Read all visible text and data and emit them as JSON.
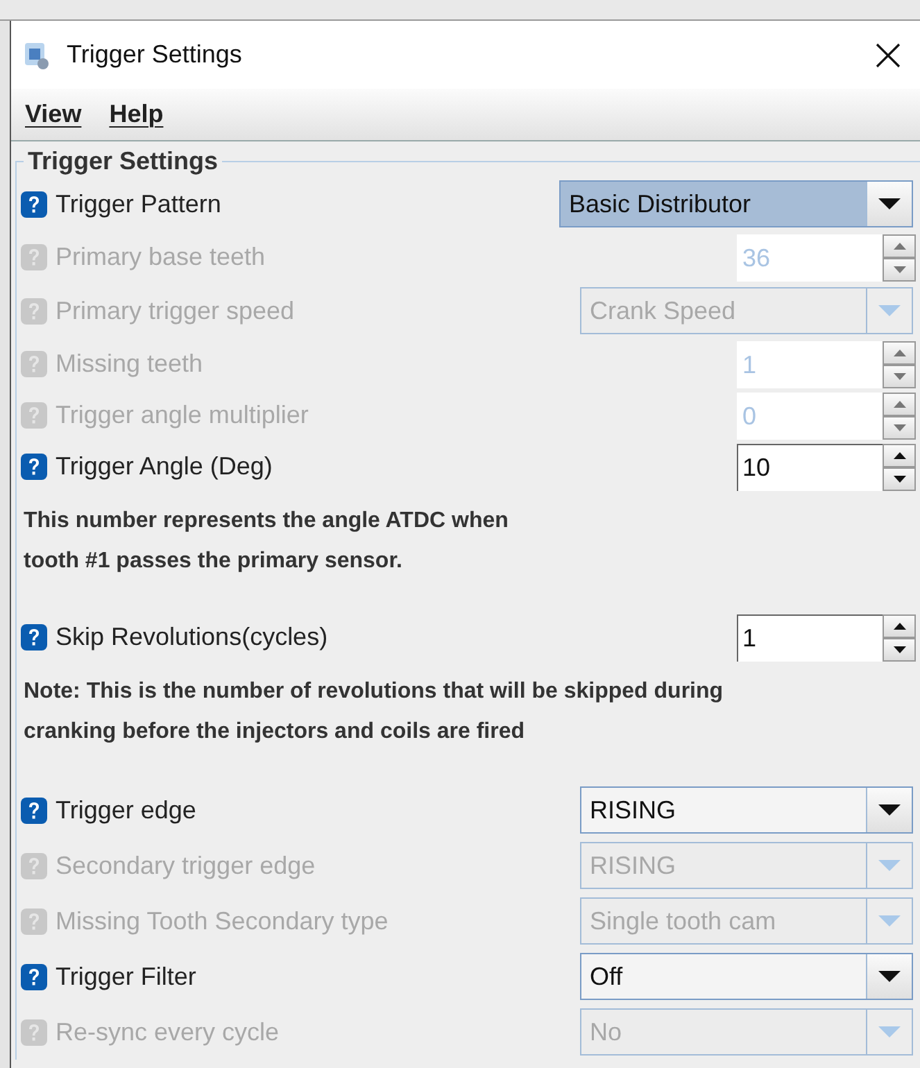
{
  "window": {
    "title": "Trigger Settings"
  },
  "menu": [
    {
      "label": "View"
    },
    {
      "label": "Help"
    }
  ],
  "group": {
    "title": "Trigger Settings"
  },
  "rows": [
    {
      "kind": "combo",
      "label": "Trigger Pattern",
      "value": "Basic Distributor",
      "disabled": false,
      "focused": true
    },
    {
      "kind": "spinner",
      "label": "Primary base teeth",
      "value": "36",
      "disabled": true
    },
    {
      "kind": "combo",
      "label": "Primary trigger speed",
      "value": "Crank Speed",
      "disabled": true,
      "focused": false
    },
    {
      "kind": "spinner",
      "label": "Missing teeth",
      "value": "1",
      "disabled": true
    },
    {
      "kind": "spinner",
      "label": "Trigger angle multiplier",
      "value": "0",
      "disabled": true
    },
    {
      "kind": "spinner",
      "label": "Trigger Angle (Deg)",
      "value": "10",
      "disabled": false
    },
    {
      "kind": "note",
      "lines": [
        "This number represents the angle ATDC when",
        "tooth #1 passes the primary sensor."
      ]
    },
    {
      "kind": "spinner",
      "label": "Skip Revolutions(cycles)",
      "value": "1",
      "disabled": false
    },
    {
      "kind": "note",
      "lines": [
        "Note: This is the number of revolutions that will be skipped during",
        "cranking before the injectors and coils are fired"
      ]
    },
    {
      "kind": "combo",
      "label": "Trigger edge",
      "value": "RISING",
      "disabled": false,
      "focused": false
    },
    {
      "kind": "combo",
      "label": "Secondary trigger edge",
      "value": "RISING",
      "disabled": true,
      "focused": false
    },
    {
      "kind": "combo",
      "label": "Missing Tooth Secondary type",
      "value": "Single tooth cam",
      "disabled": true,
      "focused": false
    },
    {
      "kind": "combo",
      "label": "Trigger Filter",
      "value": "Off",
      "disabled": false,
      "focused": false
    },
    {
      "kind": "combo",
      "label": "Re-sync every cycle",
      "value": "No",
      "disabled": true,
      "focused": false
    }
  ]
}
